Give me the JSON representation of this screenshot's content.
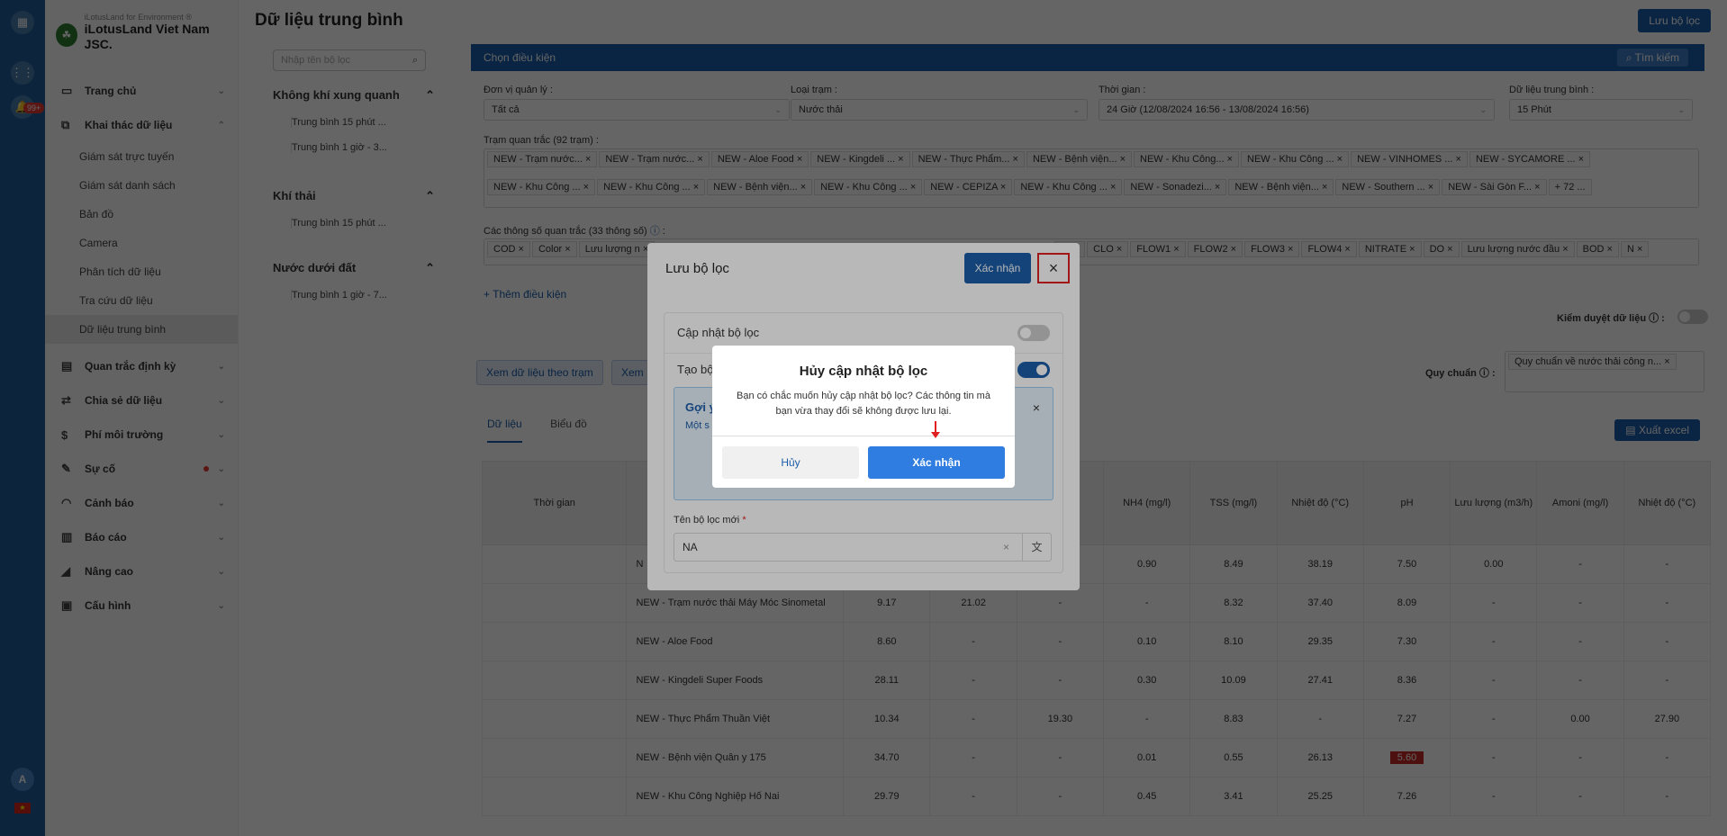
{
  "rail": {
    "badge": "99+",
    "avatar": "A",
    "flag": "★"
  },
  "brand": {
    "sub": "iLotusLand for Environment ®",
    "name": "iLotusLand Viet Nam JSC."
  },
  "menu": {
    "home": "Trang chủ",
    "mining": "Khai thác dữ liệu",
    "subs": [
      "Giám sát trực tuyến",
      "Giám sát danh sách",
      "Bản đồ",
      "Camera",
      "Phân tích dữ liệu",
      "Tra cứu dữ liệu",
      "Dữ liệu trung bình"
    ],
    "periodic": "Quan trắc định kỳ",
    "share": "Chia sẻ dữ liệu",
    "fee": "Phí môi trường",
    "incident": "Sự cố",
    "alert": "Cảnh báo",
    "report": "Báo cáo",
    "advanced": "Nâng cao",
    "config": "Cấu hình"
  },
  "page": {
    "title": "Dữ liệu trung bình",
    "save_filter": "Lưu bộ lọc"
  },
  "filters": {
    "search_placeholder": "Nhập tên bộ lọc",
    "groups": [
      {
        "title": "Không khí xung quanh",
        "items": [
          "Trung bình 15 phút ...",
          "Trung bình 1 giờ - 3..."
        ]
      },
      {
        "title": "Khí thải",
        "items": [
          "Trung bình 15 phút ..."
        ]
      },
      {
        "title": "Nước dưới đất",
        "items": [
          "Trung bình 1 giờ - 7..."
        ]
      }
    ]
  },
  "conditions": {
    "header": "Chọn điều kiện",
    "search": "Tìm kiếm",
    "unit_label": "Đơn vị quản lý :",
    "unit_value": "Tất cả",
    "type_label": "Loại trạm :",
    "type_value": "Nước thải",
    "time_label": "Thời gian :",
    "time_value": "24 Giờ (12/08/2024 16:56 - 13/08/2024 16:56)",
    "avg_label": "Dữ liệu trung bình :",
    "avg_value": "15 Phút",
    "stations_label": "Trạm quan trắc (92 trạm) :",
    "stations": [
      "NEW - Trạm nước...",
      "NEW - Trạm nước...",
      "NEW - Aloe Food",
      "NEW - Kingdeli ...",
      "NEW - Thực Phẩm...",
      "NEW - Bệnh viện...",
      "NEW - Khu Công...",
      "NEW - Khu Công ...",
      "NEW - VINHOMES ...",
      "NEW - SYCAMORE ...",
      "NEW - Khu Công ...",
      "NEW - Khu Công ...",
      "NEW - Bệnh viện...",
      "NEW - Khu Công ...",
      "NEW - CEPIZA",
      "NEW - Khu Công ...",
      "NEW - Sonadezi...",
      "NEW - Bệnh viện...",
      "NEW - Southern ...",
      "NEW - Sài Gòn F...",
      "+ 72 ..."
    ],
    "params_label": "Các thông số quan trắc (33 thông số)",
    "params_left": [
      "COD",
      "Color",
      "Lưu lượng n"
    ],
    "params_right": [
      "Cl",
      "CLO",
      "FLOW1",
      "FLOW2",
      "FLOW3",
      "FLOW4",
      "NITRATE",
      "DO",
      "Lưu lượng nước đầu",
      "BOD",
      "N"
    ],
    "add": "+ Thêm điều kiện",
    "moderation": "Kiểm duyệt dữ liệu",
    "standard_label": "Quy chuẩn",
    "standard_value": "Quy chuẩn về nước thải công n..."
  },
  "view": {
    "by_station": "Xem dữ liệu theo trạm",
    "other": "Xem",
    "tab_data": "Dữ liệu",
    "tab_chart": "Biểu đồ",
    "export": "Xuất excel"
  },
  "table": {
    "headers": [
      "Thời gian",
      "Tr",
      "",
      "",
      "",
      "NH4 (mg/l)",
      "TSS (mg/l)",
      "Nhiệt độ (°C)",
      "pH",
      "Lưu lượng (m3/h)",
      "Amoni (mg/l)",
      "Nhiệt độ (°C)"
    ],
    "rows": [
      [
        "",
        "N",
        "",
        "",
        "",
        "0.90",
        "8.49",
        "38.19",
        "7.50",
        "0.00",
        "-",
        "-"
      ],
      [
        "",
        "NEW - Trạm nước thải Máy Móc Sinometal",
        "9.17",
        "21.02",
        "-",
        "-",
        "8.32",
        "37.40",
        "8.09",
        "-",
        "-",
        "-"
      ],
      [
        "",
        "NEW - Aloe Food",
        "8.60",
        "-",
        "-",
        "0.10",
        "8.10",
        "29.35",
        "7.30",
        "-",
        "-",
        "-"
      ],
      [
        "",
        "NEW - Kingdeli Super Foods",
        "28.11",
        "-",
        "-",
        "0.30",
        "10.09",
        "27.41",
        "8.36",
        "-",
        "-",
        "-"
      ],
      [
        "",
        "NEW - Thực Phẩm Thuần Việt",
        "10.34",
        "-",
        "19.30",
        "-",
        "8.83",
        "-",
        "7.27",
        "-",
        "0.00",
        "27.90"
      ],
      [
        "",
        "NEW - Bệnh viện Quân y 175",
        "34.70",
        "-",
        "-",
        "0.01",
        "0.55",
        "26.13",
        "5.60",
        "-",
        "-",
        "-"
      ],
      [
        "",
        "NEW - Khu Công Nghiệp Hố Nai",
        "29.79",
        "-",
        "-",
        "0.45",
        "3.41",
        "25.25",
        "7.26",
        "-",
        "-",
        "-"
      ]
    ]
  },
  "modal": {
    "title": "Lưu bộ lọc",
    "confirm": "Xác nhận",
    "update_label": "Cập nhật bộ lọc",
    "create_label": "Tạo bộ",
    "hint_title": "Gợi ý",
    "hint_text": "Một s",
    "name_label": "Tên bộ lọc mới",
    "name_value": "NA"
  },
  "dialog": {
    "title": "Hủy cập nhật bộ lọc",
    "message": "Bạn có chắc muốn hủy cập nhật bộ lọc? Các thông tin mà bạn vừa thay đổi sẽ không được lưu lại.",
    "cancel": "Hủy",
    "confirm": "Xác nhận"
  }
}
